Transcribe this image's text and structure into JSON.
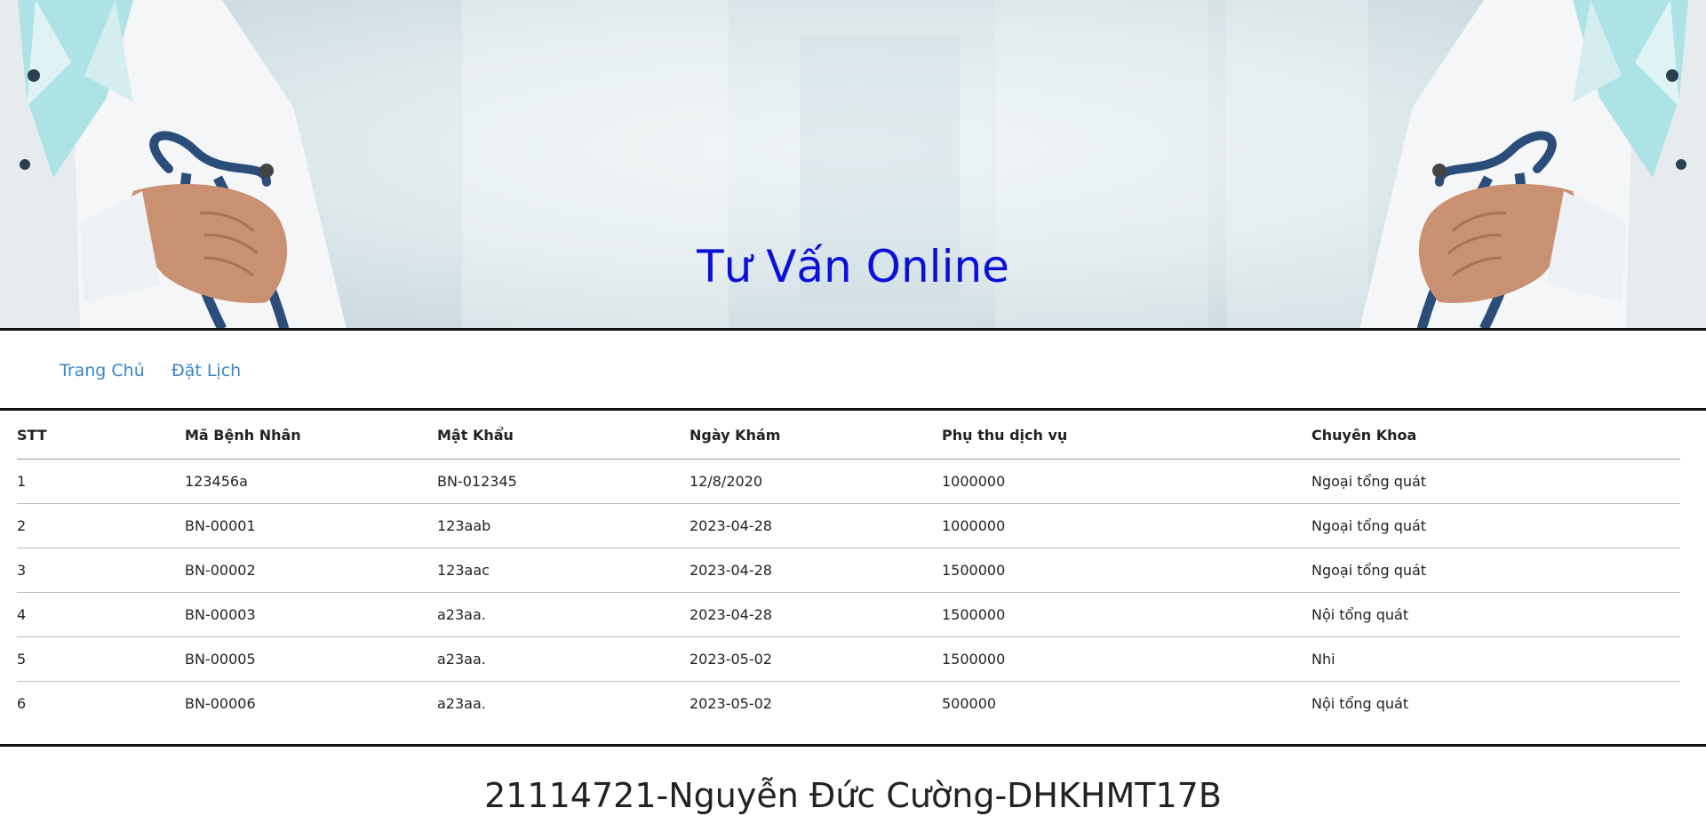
{
  "banner": {
    "title": "Tư Vấn Online",
    "title_color": "#0b10d9",
    "image_left": "doctor-with-stethoscope",
    "image_right": "doctor-with-stethoscope"
  },
  "nav": {
    "items": [
      {
        "label": "Trang Chủ"
      },
      {
        "label": "Đặt Lịch"
      }
    ],
    "link_color": "#3a86c8"
  },
  "table": {
    "headers": [
      "STT",
      "Mã Bệnh Nhân",
      "Mật Khẩu",
      "Ngày Khám",
      "Phụ thu dịch vụ",
      "Chuyên Khoa"
    ],
    "rows": [
      [
        "1",
        "123456a",
        "BN-012345",
        "12/8/2020",
        "1000000",
        "Ngoại tổng quát"
      ],
      [
        "2",
        "BN-00001",
        "123aab",
        "2023-04-28",
        "1000000",
        "Ngoại tổng quát"
      ],
      [
        "3",
        "BN-00002",
        "123aac",
        "2023-04-28",
        "1500000",
        "Ngoại tổng quát"
      ],
      [
        "4",
        "BN-00003",
        "a23aa.",
        "2023-04-28",
        "1500000",
        "Nội tổng quát"
      ],
      [
        "5",
        "BN-00005",
        "a23aa.",
        "2023-05-02",
        "1500000",
        "Nhi"
      ],
      [
        "6",
        "BN-00006",
        "a23aa.",
        "2023-05-02",
        "500000",
        "Nội tổng quát"
      ]
    ]
  },
  "footer": {
    "text": "21114721-Nguyễn Đức Cường-DHKHMT17B"
  }
}
